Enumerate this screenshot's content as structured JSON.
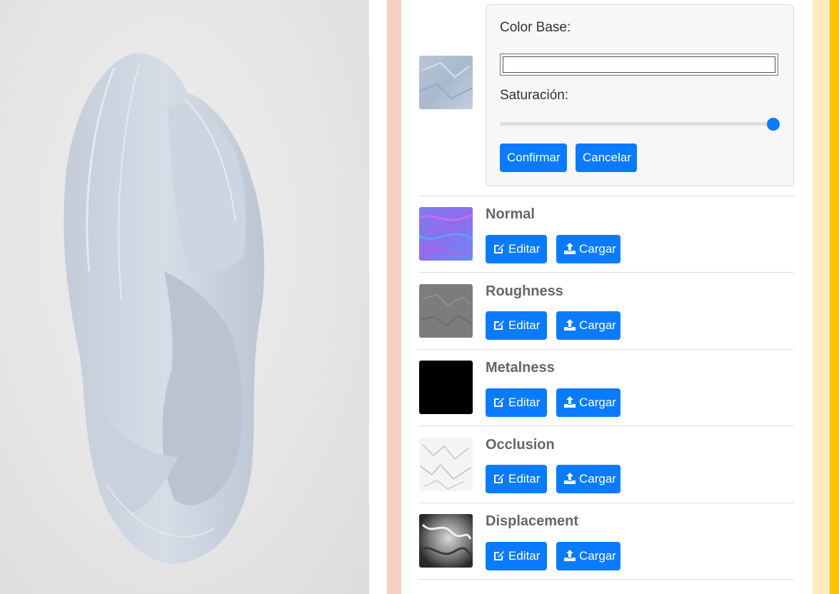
{
  "editor": {
    "color_base_label": "Color Base:",
    "color_value": "",
    "saturation_label": "Saturación:",
    "saturation_fraction": 1.0,
    "confirm_label": "Confirmar",
    "cancel_label": "Cancelar",
    "accent_color": "#0a7bff"
  },
  "maps": [
    {
      "title": "Normal",
      "edit_label": "Editar",
      "upload_label": "Cargar"
    },
    {
      "title": "Roughness",
      "edit_label": "Editar",
      "upload_label": "Cargar"
    },
    {
      "title": "Metalness",
      "edit_label": "Editar",
      "upload_label": "Cargar"
    },
    {
      "title": "Occlusion",
      "edit_label": "Editar",
      "upload_label": "Cargar"
    },
    {
      "title": "Displacement",
      "edit_label": "Editar",
      "upload_label": "Cargar"
    }
  ],
  "icons": {
    "edit": "edit-icon",
    "upload": "upload-icon"
  }
}
